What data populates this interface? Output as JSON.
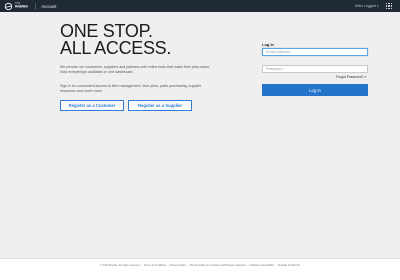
{
  "header": {
    "logo_line1": "THE",
    "logo_line2": "BOEING",
    "logo_line3": "COMPANY",
    "account_label": "Account",
    "user_label": "Hello Logged",
    "apps_icon": "grid-icon"
  },
  "hero": {
    "title_line1": "ONE STOP.",
    "title_line2": "ALL ACCESS.",
    "description1": "We provide our customers, suppliers and partners with online tools that make their jobs easier. Now everything's available on one dashboard.",
    "description2": "Sign in for convenient access to fleet management, tech pubs, parts purchasing, supplier resources and much more.",
    "register_customer": "Register as a Customer",
    "register_supplier": "Register as a Supplier"
  },
  "login": {
    "title": "Log In",
    "email_placeholder": "Email Address",
    "password_placeholder": "Password",
    "forgot_label": "Forgot Password?",
    "button_label": "Log In"
  },
  "footer": {
    "links": [
      "© 2022 Boeing. All rights reserved.",
      "Terms & Conditions",
      "Privacy Policy",
      "Privacy Policy for Cookies and Browser Sessions",
      "Website Accessibility",
      "Supplier Portal Info"
    ]
  },
  "colors": {
    "topbar": "#1f2a36",
    "accent": "#2475c9",
    "background": "#efefef"
  }
}
